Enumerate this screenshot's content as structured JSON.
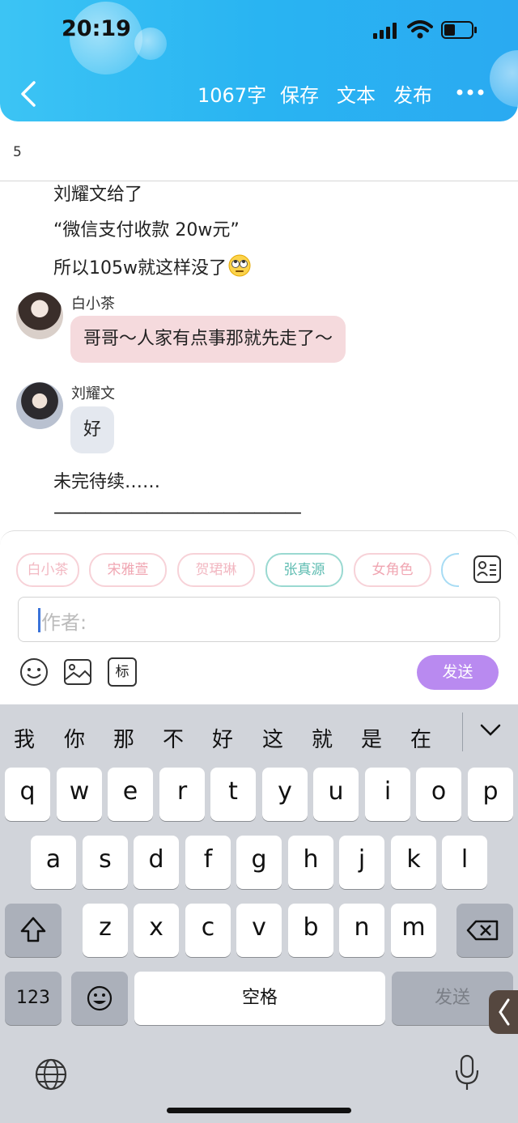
{
  "status_bar": {
    "time": "20:19"
  },
  "header": {
    "word_count": "1067字",
    "save": "保存",
    "text": "文本",
    "publish": "发布"
  },
  "counter": "5",
  "story": {
    "lines": [
      "刘耀文给了",
      "“微信支付收款 20w元”",
      "所以105w就这样没了"
    ],
    "messages": [
      {
        "name": "白小茶",
        "text": "哥哥～人家有点事那就先走了～"
      },
      {
        "name": "刘耀文",
        "text": "好"
      }
    ],
    "tail": "未完待续……",
    "divider": "————————————————"
  },
  "compose": {
    "chips": [
      "白小茶",
      "宋雅萱",
      "贺珺琳",
      "张真源",
      "女角色"
    ],
    "chip_colors": [
      "#f2b8c2",
      "#f2b8c2",
      "#f2b8c2",
      "#8fd1c9",
      "#f2b8c2"
    ],
    "author_placeholder": "作者:",
    "tag_icon_label": "标",
    "send": "发送"
  },
  "keyboard": {
    "candidates": [
      "我",
      "你",
      "那",
      "不",
      "好",
      "这",
      "就",
      "是",
      "在"
    ],
    "row1": [
      "q",
      "w",
      "e",
      "r",
      "t",
      "y",
      "u",
      "i",
      "o",
      "p"
    ],
    "row2": [
      "a",
      "s",
      "d",
      "f",
      "g",
      "h",
      "j",
      "k",
      "l"
    ],
    "row3": [
      "z",
      "x",
      "c",
      "v",
      "b",
      "n",
      "m"
    ],
    "numbers": "123",
    "space": "空格",
    "send": "发送"
  }
}
